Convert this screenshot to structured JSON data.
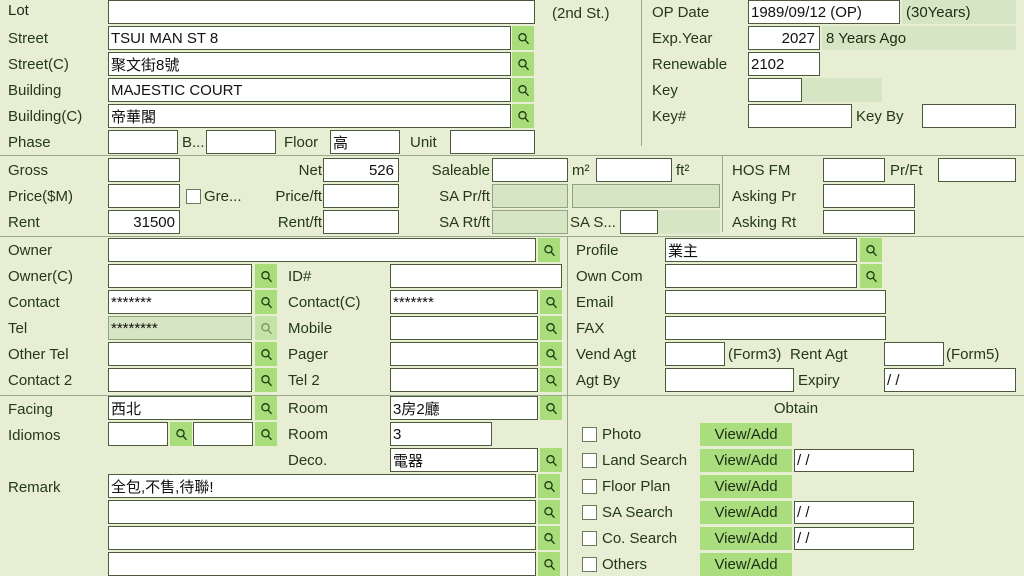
{
  "labels": {
    "lot": "Lot",
    "street": "Street",
    "street_c": "Street(C)",
    "building": "Building",
    "building_c": "Building(C)",
    "phase": "Phase",
    "block": "B...",
    "floor": "Floor",
    "unit": "Unit",
    "second_st": "(2nd St.)",
    "op_date": "OP Date",
    "exp_year": "Exp.Year",
    "renewable": "Renewable",
    "key": "Key",
    "key_num": "Key#",
    "key_by": "Key By",
    "gross": "Gross",
    "net": "Net",
    "saleable": "Saleable",
    "m2": "m²",
    "ft2": "ft²",
    "hos_fm": "HOS FM",
    "pr_ft": "Pr/Ft",
    "price_m": "Price($M)",
    "green": "Gre...",
    "price_ft": "Price/ft",
    "sa_pr_ft": "SA Pr/ft",
    "asking_pr": "Asking Pr",
    "rent": "Rent",
    "rent_ft": "Rent/ft",
    "sa_rt_ft": "SA Rt/ft",
    "sa_s": "SA S...",
    "asking_rt": "Asking Rt",
    "owner": "Owner",
    "owner_c": "Owner(C)",
    "id_num": "ID#",
    "contact": "Contact",
    "contact_c": "Contact(C)",
    "tel": "Tel",
    "mobile": "Mobile",
    "other_tel": "Other Tel",
    "pager": "Pager",
    "contact2": "Contact 2",
    "tel2": "Tel 2",
    "profile": "Profile",
    "own_com": "Own Com",
    "email": "Email",
    "fax": "FAX",
    "vend_agt": "Vend Agt",
    "form3": "(Form3)",
    "rent_agt": "Rent Agt",
    "form5": "(Form5)",
    "agt_by": "Agt By",
    "expiry": "Expiry",
    "facing": "Facing",
    "room": "Room",
    "idiomos": "Idiomos",
    "room2": "Room",
    "deco": "Deco.",
    "remark": "Remark",
    "obtain": "Obtain"
  },
  "values": {
    "lot": "",
    "street": "TSUI MAN ST 8",
    "street_c": "聚文街8號",
    "building": "MAJESTIC COURT",
    "building_c": "帝華閣",
    "phase": "",
    "block": "",
    "floor": "高",
    "unit": "",
    "op_date": "1989/09/12 (OP)",
    "op_age": "(30Years)",
    "exp_year": "2027",
    "exp_note": "8 Years Ago",
    "renewable": "2102",
    "key": "",
    "key_num": "",
    "key_by": "",
    "gross": "",
    "net": "526",
    "saleable_m2": "",
    "saleable_ft2": "",
    "hos_fm": "",
    "pr_ft": "",
    "price_m": "",
    "price_ft": "",
    "sa_pr_ft": "",
    "sa_pr_ft2": "",
    "asking_pr": "",
    "rent": "31500",
    "rent_ft": "",
    "sa_rt_ft": "",
    "sa_s": "",
    "asking_rt": "",
    "owner": "",
    "owner_c": "",
    "id_num": "",
    "contact": "*******",
    "contact_c": "*******",
    "tel": "********",
    "mobile": "",
    "other_tel": "",
    "pager": "",
    "contact2": "",
    "tel2": "",
    "profile": "業主",
    "own_com": "",
    "email": "",
    "fax": "",
    "vend_agt": "",
    "rent_agt": "",
    "agt_by": "",
    "expiry": "/  /",
    "facing": "西北",
    "room": "3房2廳",
    "idiomos_a": "",
    "idiomos_b": "",
    "room2": "3",
    "deco": "電器",
    "remark1": "全包,不售,待聯!",
    "remark2": "",
    "remark3": "",
    "remark4": ""
  },
  "checkbox_green": {
    "checked": false
  },
  "obtain": {
    "title": "Obtain",
    "button_label": "View/Add",
    "rows": [
      {
        "label": "Photo",
        "checked": false,
        "has_date": false,
        "date": ""
      },
      {
        "label": "Land Search",
        "checked": false,
        "has_date": true,
        "date": "/  /"
      },
      {
        "label": "Floor Plan",
        "checked": false,
        "has_date": false,
        "date": ""
      },
      {
        "label": "SA Search",
        "checked": false,
        "has_date": true,
        "date": "/  /"
      },
      {
        "label": "Co. Search",
        "checked": false,
        "has_date": true,
        "date": "/  /"
      },
      {
        "label": "Others",
        "checked": false,
        "has_date": false,
        "date": ""
      }
    ]
  },
  "icons": {
    "search": "search-icon"
  },
  "colors": {
    "background": "#e8eed3",
    "field_bg": "#ffffff",
    "field_border": "#4a5a3a",
    "readonly_bg": "#d6e6c4",
    "search_btn": "#a9dc7b",
    "action_btn": "#aadd7e",
    "divider": "#9aa98b",
    "text": "#23391a"
  }
}
